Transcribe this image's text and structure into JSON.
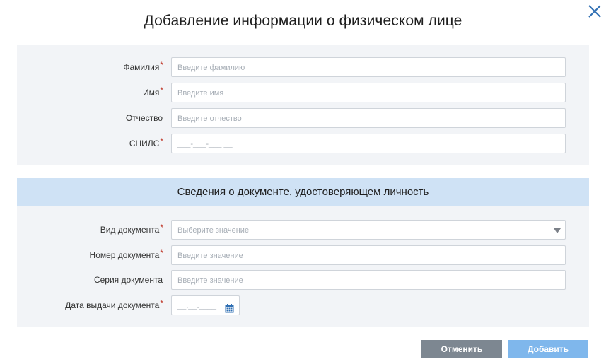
{
  "dialog": {
    "title": "Добавление информации о физическом лице"
  },
  "person": {
    "fields": [
      {
        "label": "Фамилия",
        "required": "*",
        "placeholder": "Введите фамилию"
      },
      {
        "label": "Имя",
        "required": "*",
        "placeholder": "Введите имя"
      },
      {
        "label": "Отчество",
        "required": "",
        "placeholder": "Введите отчество"
      },
      {
        "label": "СНИЛС",
        "required": "*",
        "placeholder": "___-___-___ __"
      }
    ]
  },
  "document": {
    "section_title": "Сведения о документе, удостоверяющем личность",
    "fields": [
      {
        "label": "Вид документа",
        "required": "*",
        "placeholder": "Выберите значение"
      },
      {
        "label": "Номер документа",
        "required": "*",
        "placeholder": "Введите значение"
      },
      {
        "label": "Серия документа",
        "required": "",
        "placeholder": "Введите значение"
      },
      {
        "label": "Дата выдачи документа",
        "required": "*",
        "placeholder": "__.__.____"
      }
    ]
  },
  "actions": {
    "cancel_label": "Отменить",
    "add_label": "Добавить"
  },
  "colors": {
    "accent": "#7fb7ec",
    "section_bg": "#cfe2f5",
    "required": "#c0392b",
    "icon": "#2f6fb3"
  },
  "icons": {
    "close": "close-icon",
    "dropdown": "chevron-down-icon",
    "calendar": "calendar-icon"
  }
}
